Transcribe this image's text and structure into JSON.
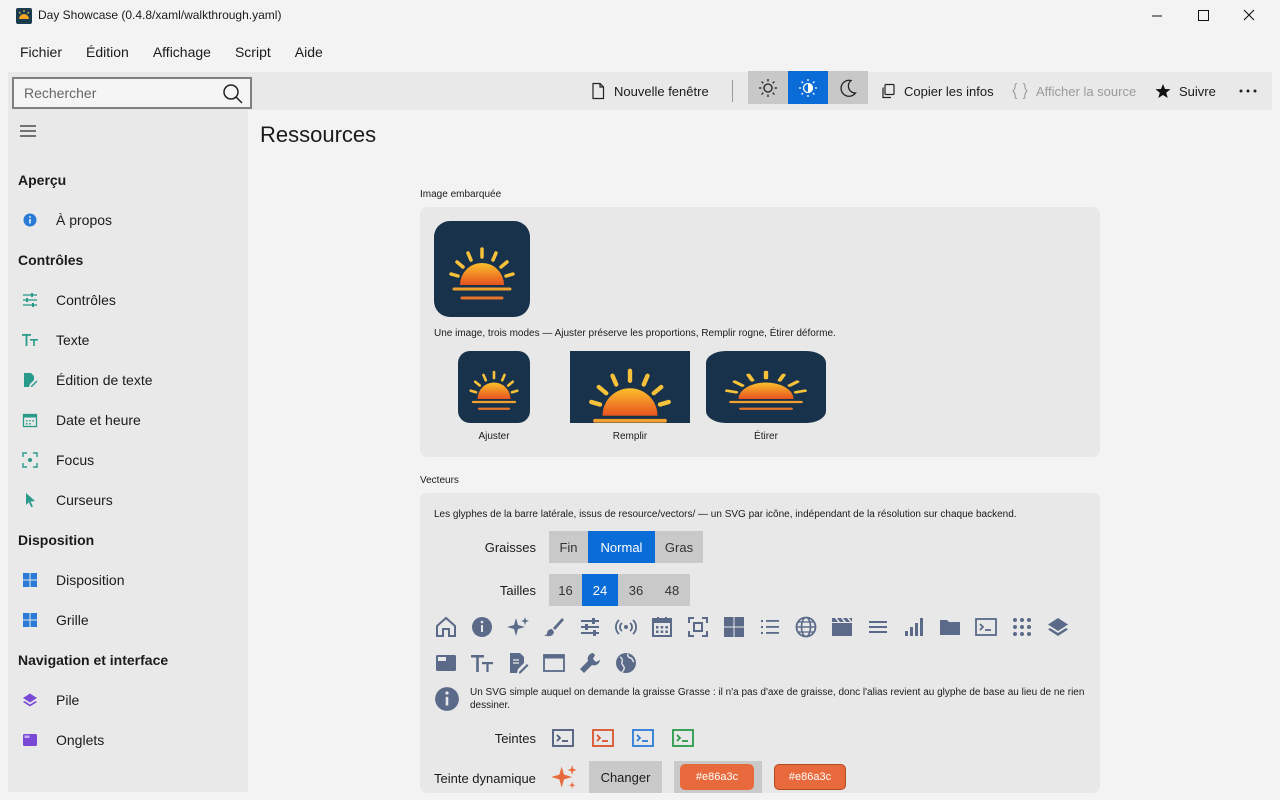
{
  "window": {
    "title": "Day Showcase (0.4.8/xaml/walkthrough.yaml)"
  },
  "menu": [
    "Fichier",
    "Édition",
    "Affichage",
    "Script",
    "Aide"
  ],
  "search": {
    "placeholder": "Rechercher",
    "value": ""
  },
  "toolbar": {
    "new_window": "Nouvelle fenêtre",
    "copy_info": "Copier les infos",
    "show_source": "Afficher la source",
    "follow": "Suivre",
    "theme_selected": "auto"
  },
  "sidebar": {
    "sections": [
      "Aperçu",
      "Contrôles",
      "Disposition",
      "Navigation et interface"
    ],
    "items": [
      {
        "label": "À propos",
        "icon": "info-icon"
      },
      {
        "label": "Contrôles",
        "icon": "sliders-icon"
      },
      {
        "label": "Texte",
        "icon": "text-size-icon"
      },
      {
        "label": "Édition de texte",
        "icon": "edit-document-icon"
      },
      {
        "label": "Date et heure",
        "icon": "calendar-icon"
      },
      {
        "label": "Focus",
        "icon": "focus-icon"
      },
      {
        "label": "Curseurs",
        "icon": "cursor-icon"
      },
      {
        "label": "Disposition",
        "icon": "layout-grid-icon"
      },
      {
        "label": "Grille",
        "icon": "grid-icon"
      },
      {
        "label": "Pile",
        "icon": "layers-icon"
      },
      {
        "label": "Onglets",
        "icon": "tabs-icon"
      }
    ]
  },
  "page": {
    "title": "Ressources"
  },
  "embedded": {
    "group_title": "Image embarquée",
    "caption": "Une image, trois modes — Ajuster préserve les proportions, Remplir rogne, Étirer déforme.",
    "modes": [
      "Ajuster",
      "Remplir",
      "Étirer"
    ]
  },
  "vectors": {
    "group_title": "Vecteurs",
    "caption": "Les glyphes de la barre latérale, issus de resource/vectors/ — un SVG par icône, indépendant de la résolution sur chaque backend.",
    "weights_label": "Graisses",
    "weights": [
      "Fin",
      "Normal",
      "Gras"
    ],
    "weight_selected": "Normal",
    "sizes_label": "Tailles",
    "sizes": [
      "16",
      "24",
      "36",
      "48"
    ],
    "size_selected": "24",
    "note": "Un SVG simple auquel on demande la graisse Grasse : il n'a pas d'axe de graisse, donc l'alias revient au glyphe de base au lieu de ne rien dessiner.",
    "tints_label": "Teintes",
    "tint_colors": [
      "#4a5a7a",
      "#d9532b",
      "#2b7bd6",
      "#2a9a4a"
    ],
    "dynamic_label": "Teinte dynamique",
    "change_button": "Changer",
    "dynamic_color": "#e86a3c"
  },
  "colors": {
    "accent": "#0a6cd6",
    "glyph": "#5a6a88"
  }
}
